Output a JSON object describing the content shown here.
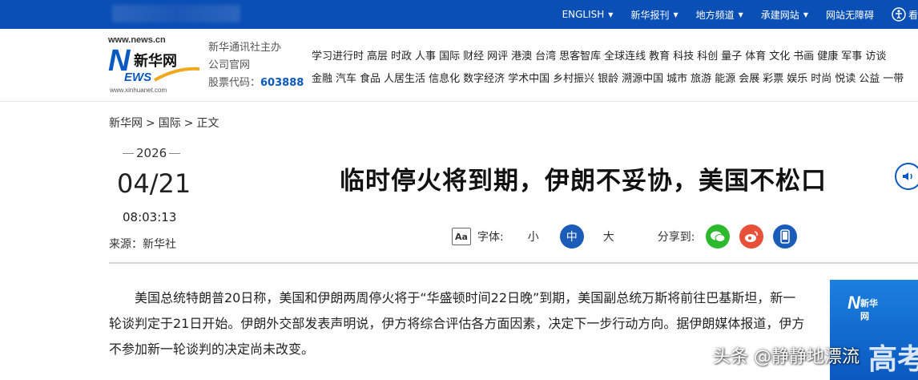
{
  "topnav": {
    "items": [
      {
        "label": "ENGLISH",
        "has_dropdown": true
      },
      {
        "label": "新华报刊",
        "has_dropdown": true
      },
      {
        "label": "地方频道",
        "has_dropdown": true
      },
      {
        "label": "承建网站",
        "has_dropdown": true
      },
      {
        "label": "网站无障碍",
        "has_dropdown": false
      },
      {
        "label": "看",
        "icon": "accessibility-icon"
      }
    ],
    "bg_color": "#0a4fb5"
  },
  "logo": {
    "url_top": "www.news.cn",
    "name_cn": "新华网",
    "letter_n": "N",
    "letters_ews": "EWS",
    "url_bottom": "www.xinhuanet.com"
  },
  "org": {
    "line1": "新华通讯社主办",
    "line2": "公司官网",
    "stock_label": "股票代码：",
    "stock_code": "603888"
  },
  "channels": {
    "row1": [
      "学习进行时",
      "高层",
      "时政",
      "人事",
      "国际",
      "财经",
      "网评",
      "港澳",
      "台湾",
      "思客智库",
      "全球连线",
      "教育",
      "科技",
      "科创",
      "量子",
      "体育",
      "文化",
      "书画",
      "健康",
      "军事",
      "访谈"
    ],
    "row2": [
      "金融",
      "汽车",
      "食品",
      "人居生活",
      "信息化",
      "数字经济",
      "学术中国",
      "乡村振兴",
      "银龄",
      "溯源中国",
      "城市",
      "旅游",
      "能源",
      "会展",
      "彩票",
      "娱乐",
      "时尚",
      "悦读",
      "公益",
      "一带"
    ]
  },
  "breadcrumb": {
    "items": [
      "新华网",
      "国际",
      "正文"
    ],
    "separator": ">"
  },
  "meta": {
    "year": "2026",
    "date": "04/21",
    "time": "08:03:13",
    "source": "来源：新华社"
  },
  "article": {
    "title": "临时停火将到期，伊朗不妥协，美国不松口",
    "paragraph": "美国总统特朗普20日称，美国和伊朗两周停火将于“华盛顿时间22日晚”到期，美国副总统万斯将前往巴基斯坦，新一轮谈判定于21日开始。伊朗外交部发表声明说，伊方将综合评估各方面因素，决定下一步行动方向。据伊朗媒体报道，伊方不参加新一轮谈判的决定尚未改变。"
  },
  "font_controls": {
    "icon_text": "Aa",
    "label": "字体:",
    "sizes": [
      "小",
      "中",
      "大"
    ],
    "selected": "中",
    "active_color": "#1a5cb8"
  },
  "share": {
    "label": "分享到:",
    "targets": [
      {
        "name": "wechat",
        "icon": "wechat-icon",
        "color": "#2db92d"
      },
      {
        "name": "weibo",
        "icon": "weibo-icon",
        "color": "#e8503a"
      },
      {
        "name": "mobile",
        "icon": "mobile-icon",
        "color": "#1a5cb8"
      }
    ]
  },
  "ad": {
    "logo": "新华网",
    "text": "高考"
  },
  "watermark": "头条 @静静地漂流"
}
